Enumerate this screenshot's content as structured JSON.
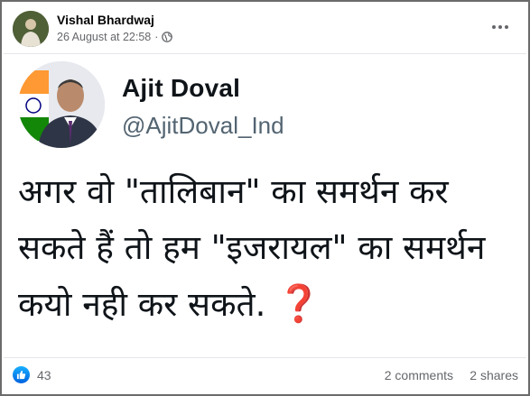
{
  "post": {
    "author": "Vishal Bhardwaj",
    "timestamp": "26 August at 22:58",
    "separator": "·",
    "audience_icon": "globe-icon",
    "more_icon": "more-options-icon"
  },
  "tweet": {
    "name": "Ajit Doval",
    "handle": "@AjitDoval_Ind",
    "text": "अगर वो \"तालिबान\" का समर्थन कर सकते हैं तो हम \"इजरायल\" का समर्थन कयो नही कर सकते.",
    "emoji": "❓"
  },
  "footer": {
    "like_count": "43",
    "comments": "2 comments",
    "shares": "2 shares"
  },
  "colors": {
    "like_blue": "#1877f2",
    "meta_gray": "#65676b",
    "question_red": "#e0245e"
  }
}
